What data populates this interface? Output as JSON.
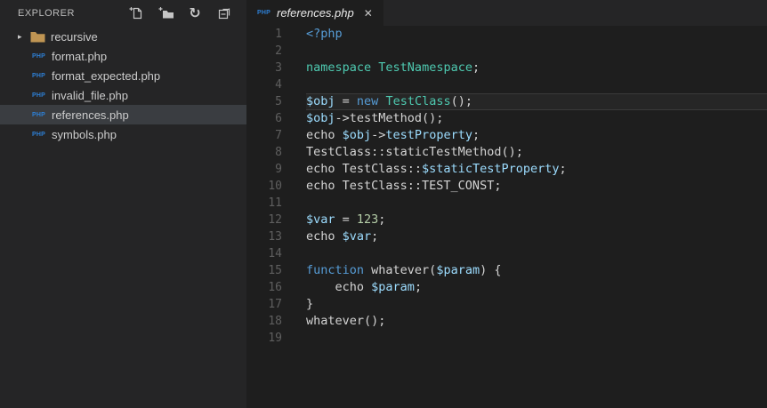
{
  "explorer": {
    "title": "EXPLORER",
    "actions": [
      {
        "name": "new-file"
      },
      {
        "name": "new-folder"
      },
      {
        "name": "refresh"
      },
      {
        "name": "collapse-all"
      }
    ],
    "tree": [
      {
        "kind": "folder",
        "label": "recursive",
        "state": "collapsed"
      },
      {
        "kind": "file",
        "label": "format.php",
        "icon": "php"
      },
      {
        "kind": "file",
        "label": "format_expected.php",
        "icon": "php"
      },
      {
        "kind": "file",
        "label": "invalid_file.php",
        "icon": "php"
      },
      {
        "kind": "file",
        "label": "references.php",
        "icon": "php",
        "selected": true
      },
      {
        "kind": "file",
        "label": "symbols.php",
        "icon": "php"
      }
    ]
  },
  "tabbar": {
    "tabs": [
      {
        "label": "references.php",
        "icon": "php",
        "active": true,
        "preview": true,
        "close": "✕"
      }
    ]
  },
  "icons": {
    "php_badge": "PHP",
    "chevron_collapsed": "▸",
    "refresh": "↻"
  },
  "editor": {
    "language": "php",
    "current_line": 5,
    "lines": [
      {
        "n": 1,
        "tokens": [
          {
            "t": "<?php",
            "c": "kw"
          }
        ]
      },
      {
        "n": 2,
        "tokens": []
      },
      {
        "n": 3,
        "tokens": [
          {
            "t": "namespace",
            "c": "type"
          },
          {
            "t": " ",
            "c": "plain"
          },
          {
            "t": "TestNamespace",
            "c": "type"
          },
          {
            "t": ";",
            "c": "plain"
          }
        ]
      },
      {
        "n": 4,
        "tokens": []
      },
      {
        "n": 5,
        "tokens": [
          {
            "t": "$obj",
            "c": "var"
          },
          {
            "t": " = ",
            "c": "plain"
          },
          {
            "t": "new",
            "c": "kw"
          },
          {
            "t": " ",
            "c": "plain"
          },
          {
            "t": "TestClass",
            "c": "type"
          },
          {
            "t": "();",
            "c": "plain"
          }
        ]
      },
      {
        "n": 6,
        "tokens": [
          {
            "t": "$obj",
            "c": "var"
          },
          {
            "t": "->testMethod();",
            "c": "plain"
          }
        ]
      },
      {
        "n": 7,
        "tokens": [
          {
            "t": "echo ",
            "c": "plain"
          },
          {
            "t": "$obj",
            "c": "var"
          },
          {
            "t": "->",
            "c": "plain"
          },
          {
            "t": "testProperty",
            "c": "var"
          },
          {
            "t": ";",
            "c": "plain"
          }
        ]
      },
      {
        "n": 8,
        "tokens": [
          {
            "t": "TestClass::staticTestMethod();",
            "c": "plain"
          }
        ]
      },
      {
        "n": 9,
        "tokens": [
          {
            "t": "echo TestClass::",
            "c": "plain"
          },
          {
            "t": "$staticTestProperty",
            "c": "var"
          },
          {
            "t": ";",
            "c": "plain"
          }
        ]
      },
      {
        "n": 10,
        "tokens": [
          {
            "t": "echo TestClass::TEST_CONST;",
            "c": "plain"
          }
        ]
      },
      {
        "n": 11,
        "tokens": []
      },
      {
        "n": 12,
        "tokens": [
          {
            "t": "$var",
            "c": "var"
          },
          {
            "t": " = ",
            "c": "plain"
          },
          {
            "t": "123",
            "c": "num"
          },
          {
            "t": ";",
            "c": "plain"
          }
        ]
      },
      {
        "n": 13,
        "tokens": [
          {
            "t": "echo ",
            "c": "plain"
          },
          {
            "t": "$var",
            "c": "var"
          },
          {
            "t": ";",
            "c": "plain"
          }
        ]
      },
      {
        "n": 14,
        "tokens": []
      },
      {
        "n": 15,
        "tokens": [
          {
            "t": "function",
            "c": "kw"
          },
          {
            "t": " whatever(",
            "c": "plain"
          },
          {
            "t": "$param",
            "c": "var"
          },
          {
            "t": ") {",
            "c": "plain"
          }
        ]
      },
      {
        "n": 16,
        "tokens": [
          {
            "t": "    echo ",
            "c": "plain"
          },
          {
            "t": "$param",
            "c": "var"
          },
          {
            "t": ";",
            "c": "plain"
          }
        ]
      },
      {
        "n": 17,
        "tokens": [
          {
            "t": "}",
            "c": "plain"
          }
        ]
      },
      {
        "n": 18,
        "tokens": [
          {
            "t": "whatever();",
            "c": "plain"
          }
        ]
      },
      {
        "n": 19,
        "tokens": []
      }
    ]
  },
  "colors": {
    "keyword": "#569CD6",
    "type": "#4EC9B0",
    "variable": "#9CDCFE",
    "number": "#B5CEA8",
    "plain": "#D4D4D4",
    "php_icon": "#2D7FD4",
    "folder_icon": "#C09553",
    "editor_bg": "#1E1E1E",
    "sidebar_bg": "#252526",
    "selected_row_bg": "#3A3D41",
    "line_number": "#5F5F5F"
  }
}
